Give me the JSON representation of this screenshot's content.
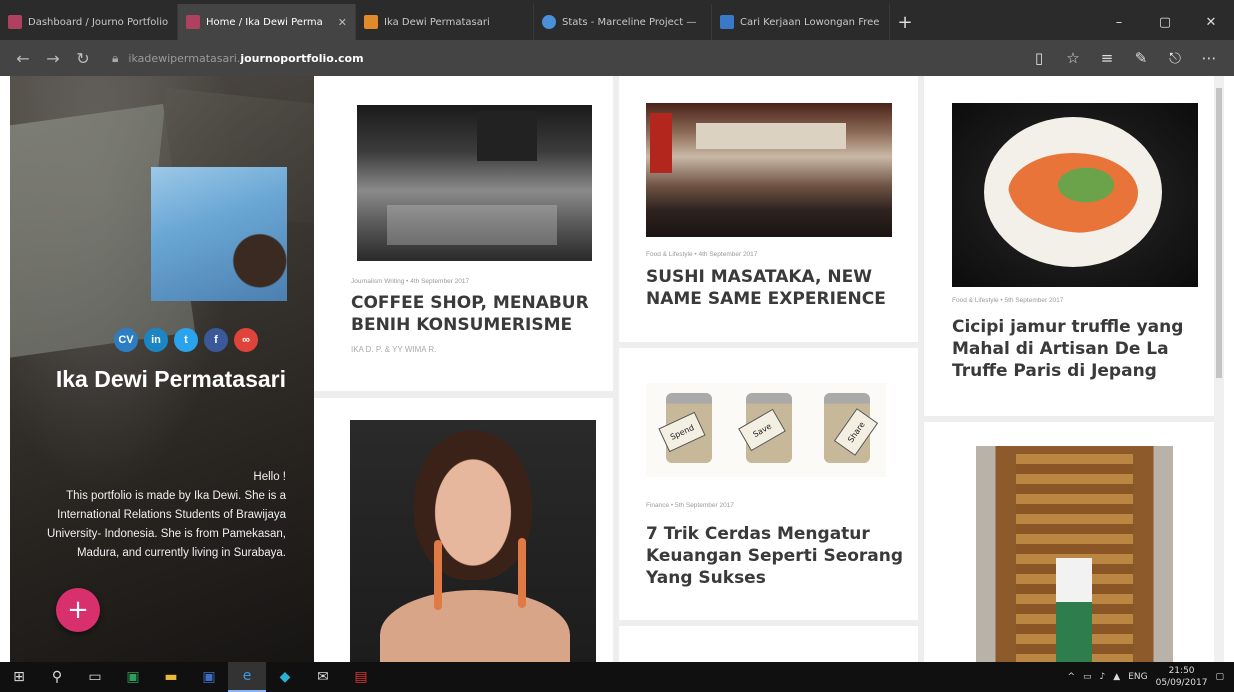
{
  "browser": {
    "tabs": [
      {
        "label": "Dashboard / Journo Portfolio",
        "active": false,
        "favicon_color": "#b04060"
      },
      {
        "label": "Home / Ika Dewi Perma",
        "active": true,
        "favicon_color": "#b04060"
      },
      {
        "label": "Ika Dewi Permatasari",
        "active": false,
        "favicon_color": "#e08a2a"
      },
      {
        "label": "Stats - Marceline Project —",
        "active": false,
        "favicon_color": "#4a90d9"
      },
      {
        "label": "Cari Kerjaan Lowongan Free",
        "active": false,
        "favicon_color": "#3a78c8"
      }
    ],
    "new_tab_glyph": "+",
    "window_controls": [
      "–",
      "▢",
      "✕"
    ],
    "url_subdomain": "ikadewipermatasari.",
    "url_domain": "journoportfolio.com"
  },
  "sidebar": {
    "name": "Ika Dewi Permatasari",
    "socials": [
      {
        "icon": "cv-icon",
        "text": "CV",
        "color": "#2d7dc3"
      },
      {
        "icon": "linkedin-icon",
        "text": "in",
        "color": "#1c86c4"
      },
      {
        "icon": "twitter-icon",
        "text": "t",
        "color": "#2aa3ef"
      },
      {
        "icon": "facebook-icon",
        "text": "f",
        "color": "#3b5998"
      },
      {
        "icon": "link-icon",
        "text": "∞",
        "color": "#e0433a"
      }
    ],
    "bio_greeting": "Hello !",
    "bio": "This portfolio is made by Ika Dewi. She is a International Relations Students of Brawijaya University- Indonesia. She is from Pamekasan, Madura, and currently living in Surabaya.",
    "fab_glyph": "+"
  },
  "posts": [
    {
      "meta": "Journalism Writing • 4th September 2017",
      "title": "COFFEE SHOP, MENABUR BENIH KONSUMERISME",
      "author": "IKA D. P. & YY WIMA R."
    },
    {
      "meta": "Food & Lifestyle • 4th September 2017",
      "title": "SUSHI MASATAKA, NEW NAME SAME EXPERIENCE"
    },
    {
      "meta": "Food & Lifestyle • 5th September 2017",
      "title": "Cicipi jamur truffle yang Mahal di Artisan De La Truffe Paris di Jepang"
    },
    {
      "meta": "Finance • 5th September 2017",
      "title": "7 Trik Cerdas Mengatur Keuangan Seperti Seorang Yang Sukses"
    }
  ],
  "jar_labels": [
    "Spend",
    "Save",
    "Share"
  ],
  "taskbar": {
    "time": "21:50",
    "date": "05/09/2017",
    "lang": "ENG"
  }
}
